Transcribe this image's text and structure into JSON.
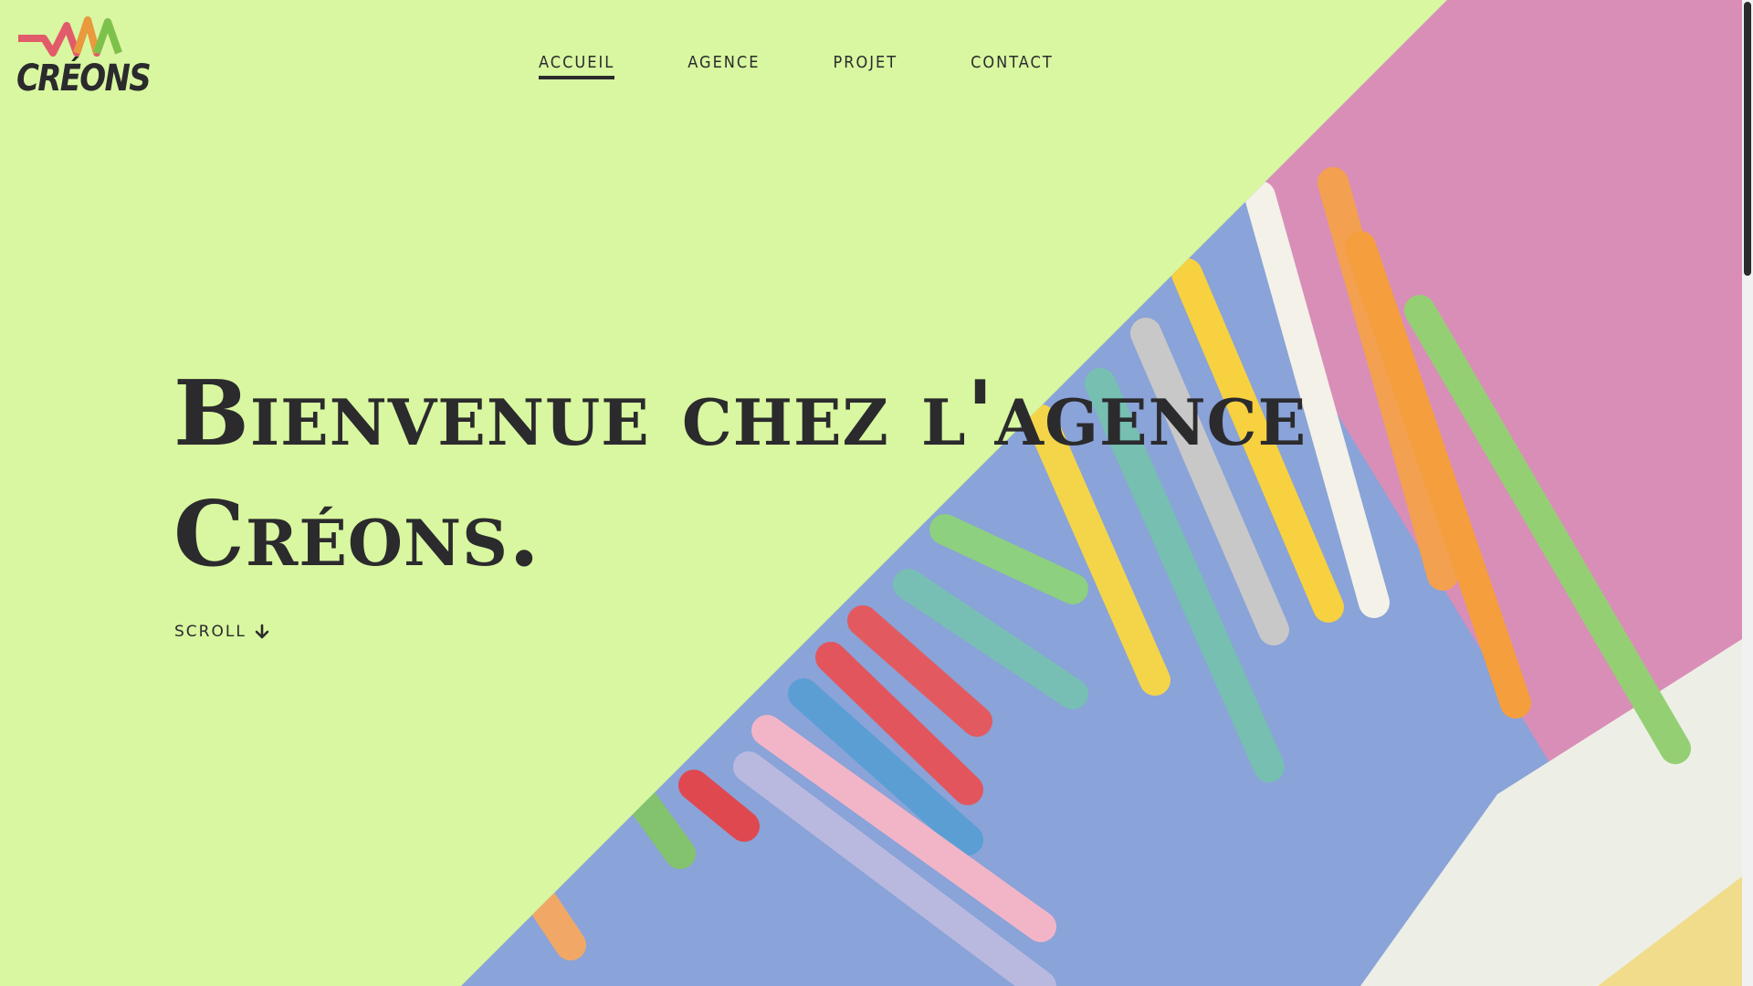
{
  "brand": {
    "name": "CRÉONS",
    "logo_colors": [
      "#e25b6a",
      "#e89a3c",
      "#7cc24a"
    ]
  },
  "nav": {
    "items": [
      {
        "label": "ACCUEIL",
        "active": true
      },
      {
        "label": "AGENCE",
        "active": false
      },
      {
        "label": "PROJET",
        "active": false
      },
      {
        "label": "CONTACT",
        "active": false
      }
    ]
  },
  "hero": {
    "headline": "Bienvenue chez l'agence Créons.",
    "scroll_label": "SCROLL",
    "scroll_icon": "arrow-down-icon",
    "image_subject": "crayons",
    "background_color": "#d8f7a0",
    "text_color": "#2b2a2d"
  }
}
